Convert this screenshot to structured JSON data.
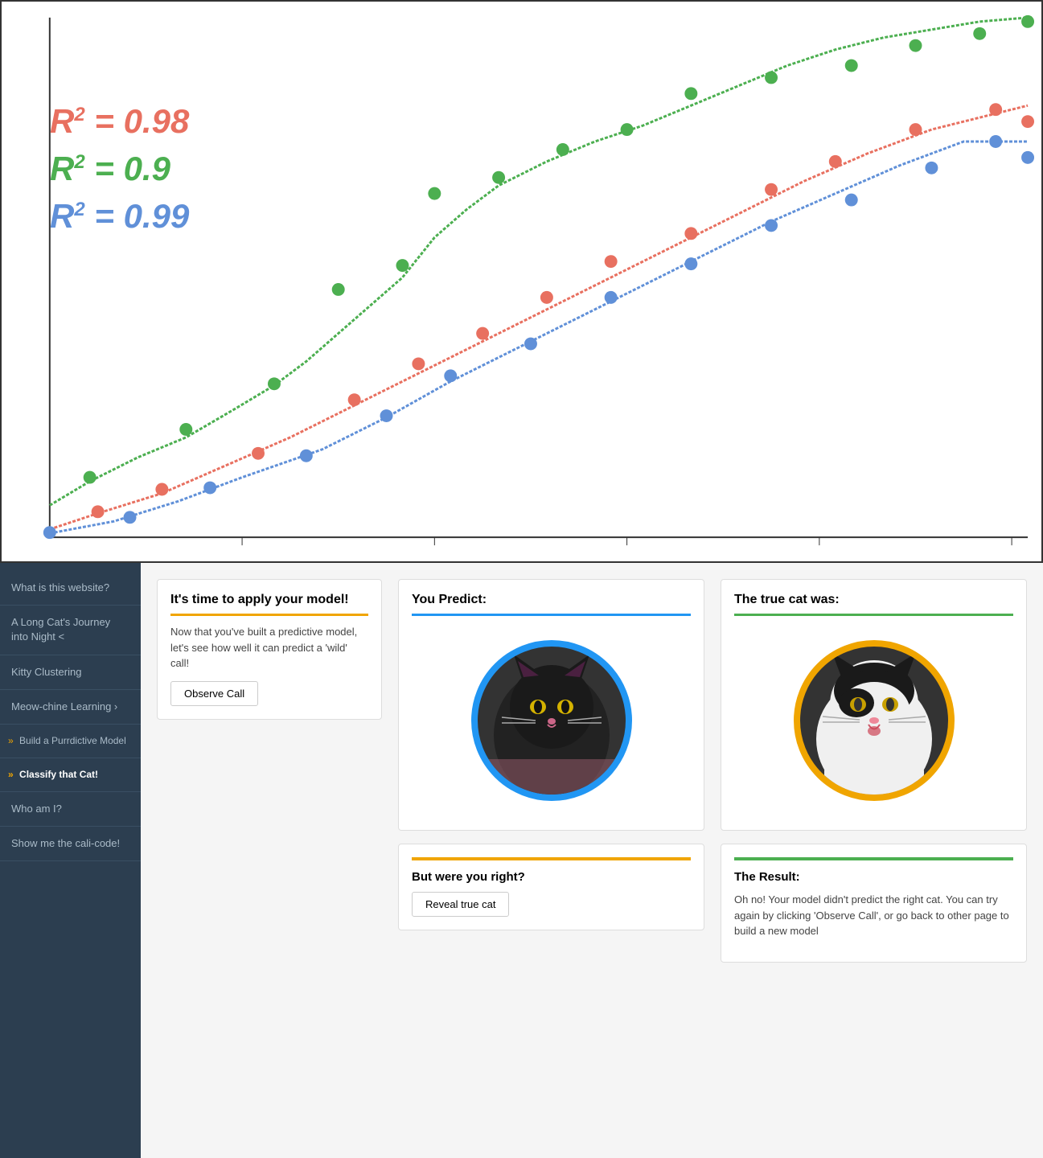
{
  "chart": {
    "r2_labels": [
      {
        "id": "r2-red",
        "value": "R² = 0.98",
        "color": "#e87060"
      },
      {
        "id": "r2-green",
        "value": "R² = 0.9",
        "color": "#4caf50"
      },
      {
        "id": "r2-blue",
        "value": "R² = 0.99",
        "color": "#6090d8"
      }
    ]
  },
  "sidebar": {
    "items": [
      {
        "id": "what-is-website",
        "label": "What is this website?",
        "active": false
      },
      {
        "id": "long-cat",
        "label": "A Long Cat's Journey into Night <",
        "active": false
      },
      {
        "id": "kitty-clustering",
        "label": "Kitty Clustering",
        "active": false
      },
      {
        "id": "meow-chine-learning",
        "label": "Meow-chine Learning",
        "active": false,
        "has_arrow": true
      },
      {
        "id": "build-model",
        "label": "Build a Purrdictive Model",
        "active": false,
        "sub": true
      },
      {
        "id": "classify-cat",
        "label": "Classify that Cat!",
        "active": true,
        "sub": true
      },
      {
        "id": "who-am-i",
        "label": "Who am I?",
        "active": false
      },
      {
        "id": "show-cali-code",
        "label": "Show me the cali-code!",
        "active": false
      }
    ]
  },
  "apply_model": {
    "title": "It's time to apply your model!",
    "body": "Now that you've built a predictive model, let's see how well it can predict a 'wild' call!",
    "observe_button": "Observe Call"
  },
  "you_predict": {
    "title": "You Predict:",
    "circle_color": "#2196F3"
  },
  "true_cat": {
    "title": "The true cat was:",
    "circle_color": "#f0a500"
  },
  "were_you_right": {
    "title": "But were you right?",
    "reveal_button": "Reveal true cat"
  },
  "result": {
    "title": "The Result:",
    "body": "Oh no! Your model didn't predict the right cat. You can try again by clicking 'Observe Call', or go back to other page to build a new model"
  }
}
